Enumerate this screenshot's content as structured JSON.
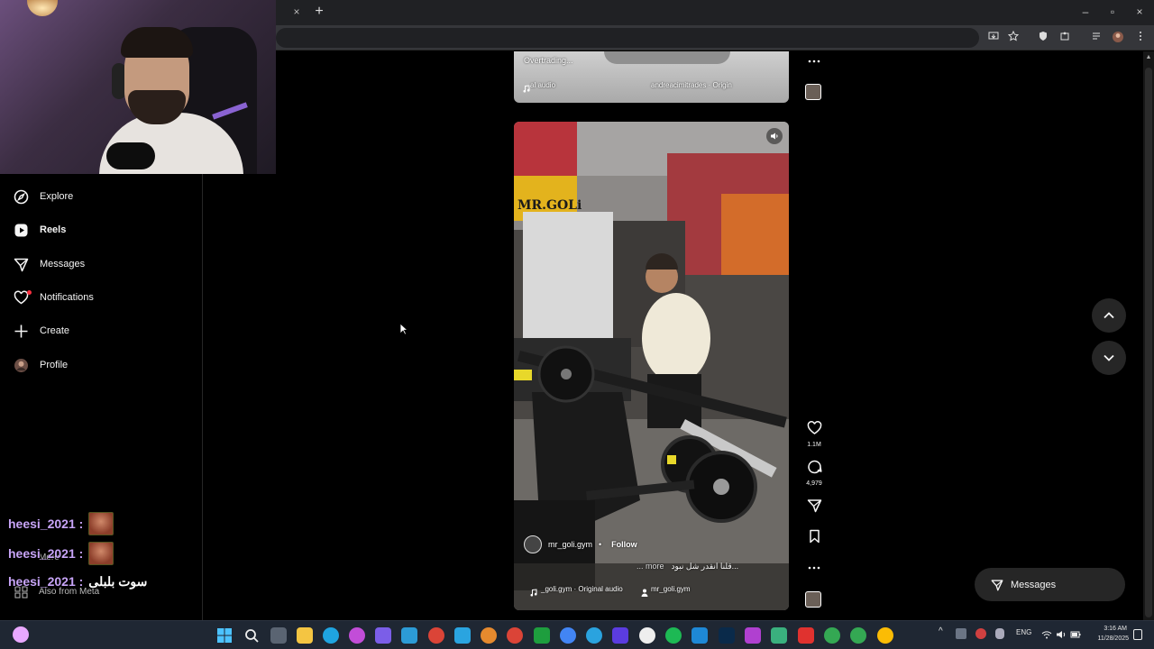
{
  "browser": {
    "close_tab": "×",
    "new_tab": "+",
    "minimize": "–",
    "maximize": "▫",
    "close": "×"
  },
  "sidebar": {
    "items": [
      {
        "label": "Explore",
        "icon": "compass-icon"
      },
      {
        "label": "Reels",
        "icon": "reels-icon"
      },
      {
        "label": "Messages",
        "icon": "paper-plane-icon"
      },
      {
        "label": "Notifications",
        "icon": "heart-icon"
      },
      {
        "label": "Create",
        "icon": "plus-icon"
      },
      {
        "label": "Profile",
        "icon": "avatar"
      }
    ],
    "more_label": "More",
    "also_from_meta": "Also from Meta"
  },
  "chat": [
    {
      "user": "heesi_2021 :",
      "message": "",
      "emote": true
    },
    {
      "user": "heesi_2021 :",
      "message": "",
      "emote": true
    },
    {
      "user": "heesi_2021 :",
      "message": "سوت بلبلی",
      "emote": false
    }
  ],
  "reel_previous": {
    "caption": "Overtrading...",
    "audio": "al audio",
    "source": "andreacimitrades · Origin"
  },
  "reel_current": {
    "gym_sign": "MR.GOLi",
    "username": "mr_goli.gym",
    "separator": "•",
    "follow": "Follow",
    "caption": "قلنا انقدر شل نبود...",
    "more": "... more",
    "audio": "_goli.gym · Original audio",
    "owner": "mr_goli.gym",
    "likes": "1.1M",
    "comments": "4,979"
  },
  "messages_pill": {
    "label": "Messages"
  },
  "taskbar": {
    "lang": "ENG",
    "time": "3:16 AM",
    "date": "11/28/2025"
  },
  "colors": {
    "background": "#000000",
    "chat_username": "#c7a4f7",
    "notification_dot": "#ff3040"
  }
}
